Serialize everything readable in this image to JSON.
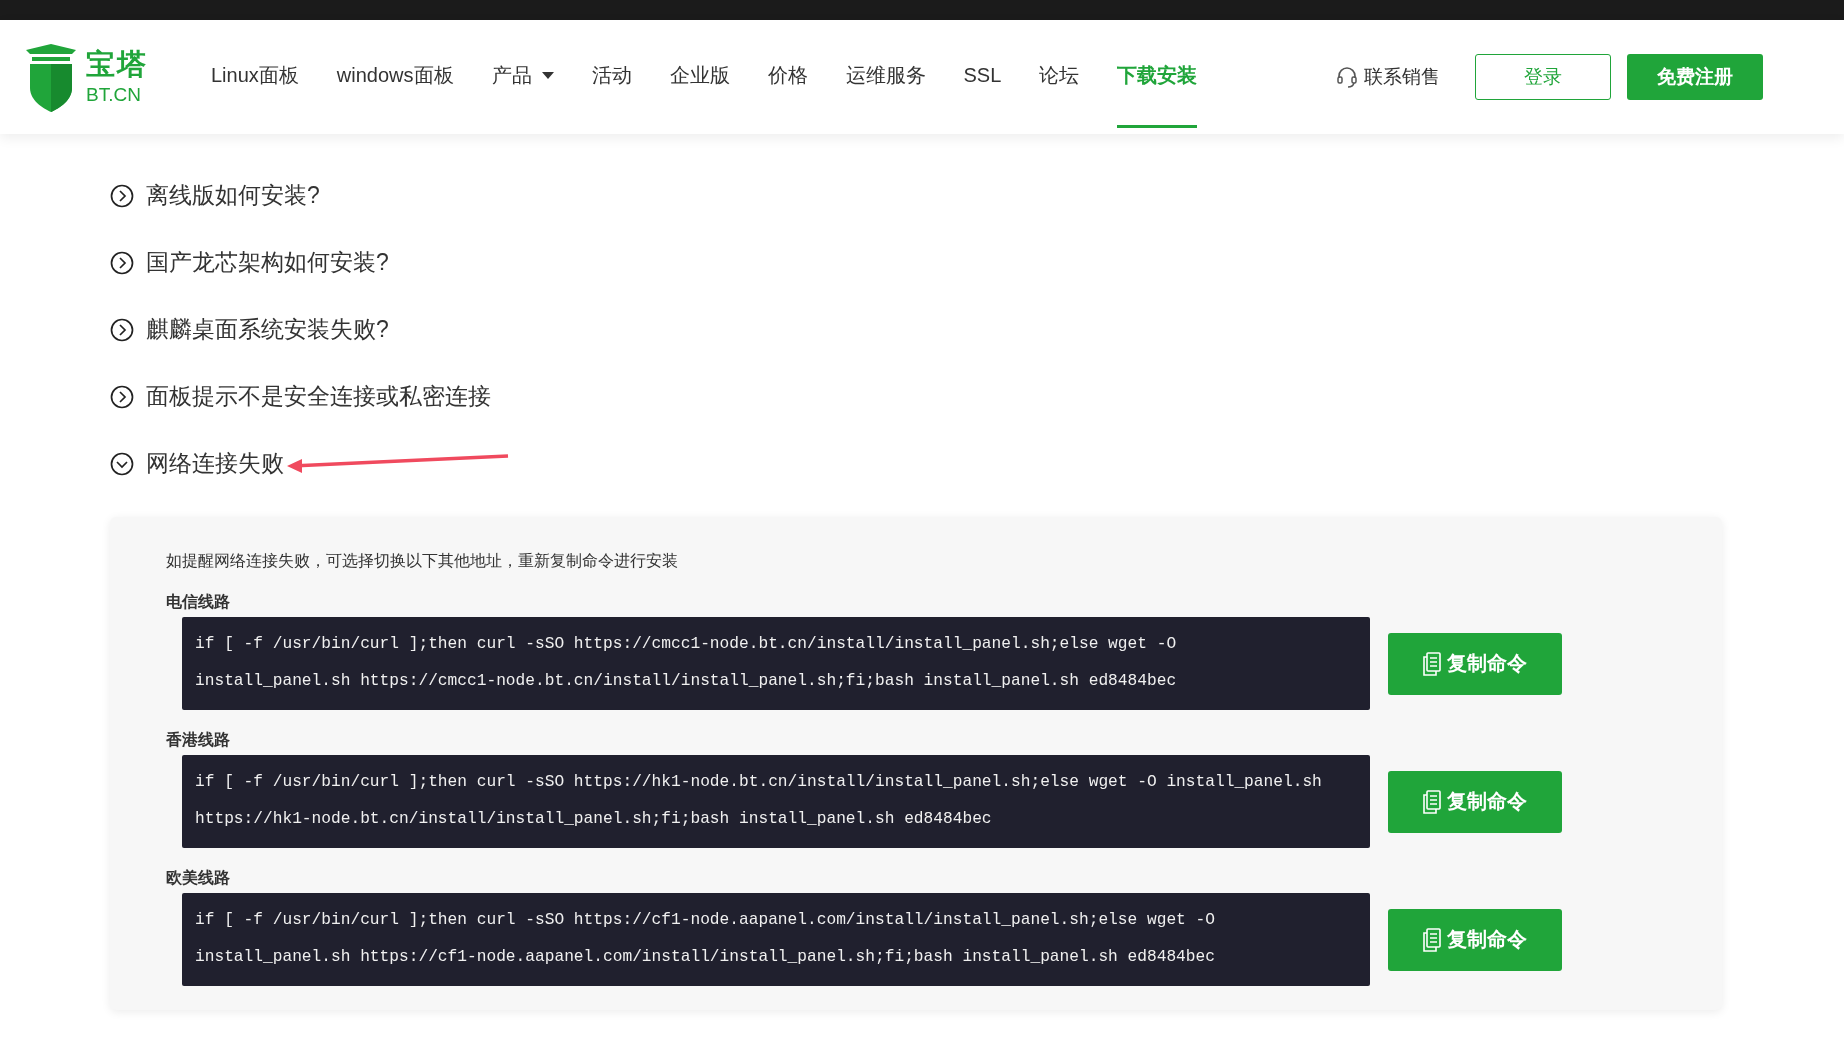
{
  "header": {
    "logo": {
      "name": "宝塔",
      "domain": "BT.CN"
    },
    "nav": [
      {
        "label": "Linux面板",
        "selected": false,
        "dropdown": false
      },
      {
        "label": "windows面板",
        "selected": false,
        "dropdown": false
      },
      {
        "label": "产品",
        "selected": false,
        "dropdown": true
      },
      {
        "label": "活动",
        "selected": false,
        "dropdown": false
      },
      {
        "label": "企业版",
        "selected": false,
        "dropdown": false
      },
      {
        "label": "价格",
        "selected": false,
        "dropdown": false
      },
      {
        "label": "运维服务",
        "selected": false,
        "dropdown": false
      },
      {
        "label": "SSL",
        "selected": false,
        "dropdown": false
      },
      {
        "label": "论坛",
        "selected": false,
        "dropdown": false
      },
      {
        "label": "下载安装",
        "selected": true,
        "dropdown": false
      }
    ],
    "contact": "联系销售",
    "login": "登录",
    "register": "免费注册"
  },
  "faq": [
    {
      "question": "离线版如何安装?",
      "expanded": false
    },
    {
      "question": "国产龙芯架构如何安装?",
      "expanded": false
    },
    {
      "question": "麒麟桌面系统安装失败?",
      "expanded": false
    },
    {
      "question": "面板提示不是安全连接或私密连接",
      "expanded": false
    },
    {
      "question": "网络连接失败",
      "expanded": true
    }
  ],
  "answer": {
    "intro": "如提醒网络连接失败，可选择切换以下其他地址，重新复制命令进行安装",
    "routes": [
      {
        "name": "电信线路",
        "lines": [
          "if [ -f /usr/bin/curl ];then curl -sSO https://cmcc1-node.bt.cn/install/install_panel.sh;else wget -O",
          "install_panel.sh https://cmcc1-node.bt.cn/install/install_panel.sh;fi;bash install_panel.sh ed8484bec"
        ],
        "button": "复制命令"
      },
      {
        "name": "香港线路",
        "lines": [
          "if [ -f /usr/bin/curl ];then curl -sSO https://hk1-node.bt.cn/install/install_panel.sh;else wget -O install_panel.sh",
          "https://hk1-node.bt.cn/install/install_panel.sh;fi;bash install_panel.sh ed8484bec"
        ],
        "button": "复制命令"
      },
      {
        "name": "欧美线路",
        "lines": [
          "if [ -f /usr/bin/curl ];then curl -sSO https://cf1-node.aapanel.com/install/install_panel.sh;else wget -O",
          "install_panel.sh https://cf1-node.aapanel.com/install/install_panel.sh;fi;bash install_panel.sh ed8484bec"
        ],
        "button": "复制命令"
      }
    ]
  }
}
